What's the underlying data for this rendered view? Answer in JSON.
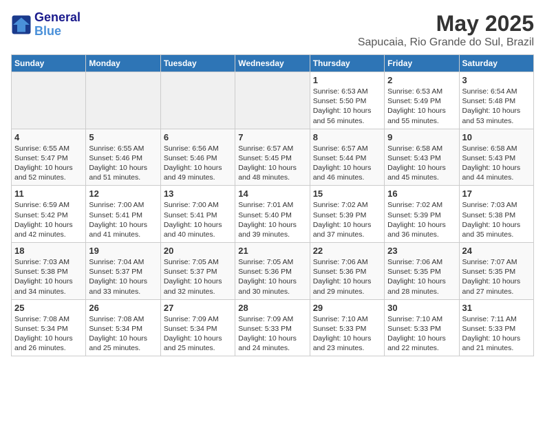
{
  "header": {
    "logo_line1": "General",
    "logo_line2": "Blue",
    "month": "May 2025",
    "location": "Sapucaia, Rio Grande do Sul, Brazil"
  },
  "weekdays": [
    "Sunday",
    "Monday",
    "Tuesday",
    "Wednesday",
    "Thursday",
    "Friday",
    "Saturday"
  ],
  "weeks": [
    [
      {
        "day": "",
        "info": ""
      },
      {
        "day": "",
        "info": ""
      },
      {
        "day": "",
        "info": ""
      },
      {
        "day": "",
        "info": ""
      },
      {
        "day": "1",
        "info": "Sunrise: 6:53 AM\nSunset: 5:50 PM\nDaylight: 10 hours\nand 56 minutes."
      },
      {
        "day": "2",
        "info": "Sunrise: 6:53 AM\nSunset: 5:49 PM\nDaylight: 10 hours\nand 55 minutes."
      },
      {
        "day": "3",
        "info": "Sunrise: 6:54 AM\nSunset: 5:48 PM\nDaylight: 10 hours\nand 53 minutes."
      }
    ],
    [
      {
        "day": "4",
        "info": "Sunrise: 6:55 AM\nSunset: 5:47 PM\nDaylight: 10 hours\nand 52 minutes."
      },
      {
        "day": "5",
        "info": "Sunrise: 6:55 AM\nSunset: 5:46 PM\nDaylight: 10 hours\nand 51 minutes."
      },
      {
        "day": "6",
        "info": "Sunrise: 6:56 AM\nSunset: 5:46 PM\nDaylight: 10 hours\nand 49 minutes."
      },
      {
        "day": "7",
        "info": "Sunrise: 6:57 AM\nSunset: 5:45 PM\nDaylight: 10 hours\nand 48 minutes."
      },
      {
        "day": "8",
        "info": "Sunrise: 6:57 AM\nSunset: 5:44 PM\nDaylight: 10 hours\nand 46 minutes."
      },
      {
        "day": "9",
        "info": "Sunrise: 6:58 AM\nSunset: 5:43 PM\nDaylight: 10 hours\nand 45 minutes."
      },
      {
        "day": "10",
        "info": "Sunrise: 6:58 AM\nSunset: 5:43 PM\nDaylight: 10 hours\nand 44 minutes."
      }
    ],
    [
      {
        "day": "11",
        "info": "Sunrise: 6:59 AM\nSunset: 5:42 PM\nDaylight: 10 hours\nand 42 minutes."
      },
      {
        "day": "12",
        "info": "Sunrise: 7:00 AM\nSunset: 5:41 PM\nDaylight: 10 hours\nand 41 minutes."
      },
      {
        "day": "13",
        "info": "Sunrise: 7:00 AM\nSunset: 5:41 PM\nDaylight: 10 hours\nand 40 minutes."
      },
      {
        "day": "14",
        "info": "Sunrise: 7:01 AM\nSunset: 5:40 PM\nDaylight: 10 hours\nand 39 minutes."
      },
      {
        "day": "15",
        "info": "Sunrise: 7:02 AM\nSunset: 5:39 PM\nDaylight: 10 hours\nand 37 minutes."
      },
      {
        "day": "16",
        "info": "Sunrise: 7:02 AM\nSunset: 5:39 PM\nDaylight: 10 hours\nand 36 minutes."
      },
      {
        "day": "17",
        "info": "Sunrise: 7:03 AM\nSunset: 5:38 PM\nDaylight: 10 hours\nand 35 minutes."
      }
    ],
    [
      {
        "day": "18",
        "info": "Sunrise: 7:03 AM\nSunset: 5:38 PM\nDaylight: 10 hours\nand 34 minutes."
      },
      {
        "day": "19",
        "info": "Sunrise: 7:04 AM\nSunset: 5:37 PM\nDaylight: 10 hours\nand 33 minutes."
      },
      {
        "day": "20",
        "info": "Sunrise: 7:05 AM\nSunset: 5:37 PM\nDaylight: 10 hours\nand 32 minutes."
      },
      {
        "day": "21",
        "info": "Sunrise: 7:05 AM\nSunset: 5:36 PM\nDaylight: 10 hours\nand 30 minutes."
      },
      {
        "day": "22",
        "info": "Sunrise: 7:06 AM\nSunset: 5:36 PM\nDaylight: 10 hours\nand 29 minutes."
      },
      {
        "day": "23",
        "info": "Sunrise: 7:06 AM\nSunset: 5:35 PM\nDaylight: 10 hours\nand 28 minutes."
      },
      {
        "day": "24",
        "info": "Sunrise: 7:07 AM\nSunset: 5:35 PM\nDaylight: 10 hours\nand 27 minutes."
      }
    ],
    [
      {
        "day": "25",
        "info": "Sunrise: 7:08 AM\nSunset: 5:34 PM\nDaylight: 10 hours\nand 26 minutes."
      },
      {
        "day": "26",
        "info": "Sunrise: 7:08 AM\nSunset: 5:34 PM\nDaylight: 10 hours\nand 25 minutes."
      },
      {
        "day": "27",
        "info": "Sunrise: 7:09 AM\nSunset: 5:34 PM\nDaylight: 10 hours\nand 25 minutes."
      },
      {
        "day": "28",
        "info": "Sunrise: 7:09 AM\nSunset: 5:33 PM\nDaylight: 10 hours\nand 24 minutes."
      },
      {
        "day": "29",
        "info": "Sunrise: 7:10 AM\nSunset: 5:33 PM\nDaylight: 10 hours\nand 23 minutes."
      },
      {
        "day": "30",
        "info": "Sunrise: 7:10 AM\nSunset: 5:33 PM\nDaylight: 10 hours\nand 22 minutes."
      },
      {
        "day": "31",
        "info": "Sunrise: 7:11 AM\nSunset: 5:33 PM\nDaylight: 10 hours\nand 21 minutes."
      }
    ]
  ]
}
